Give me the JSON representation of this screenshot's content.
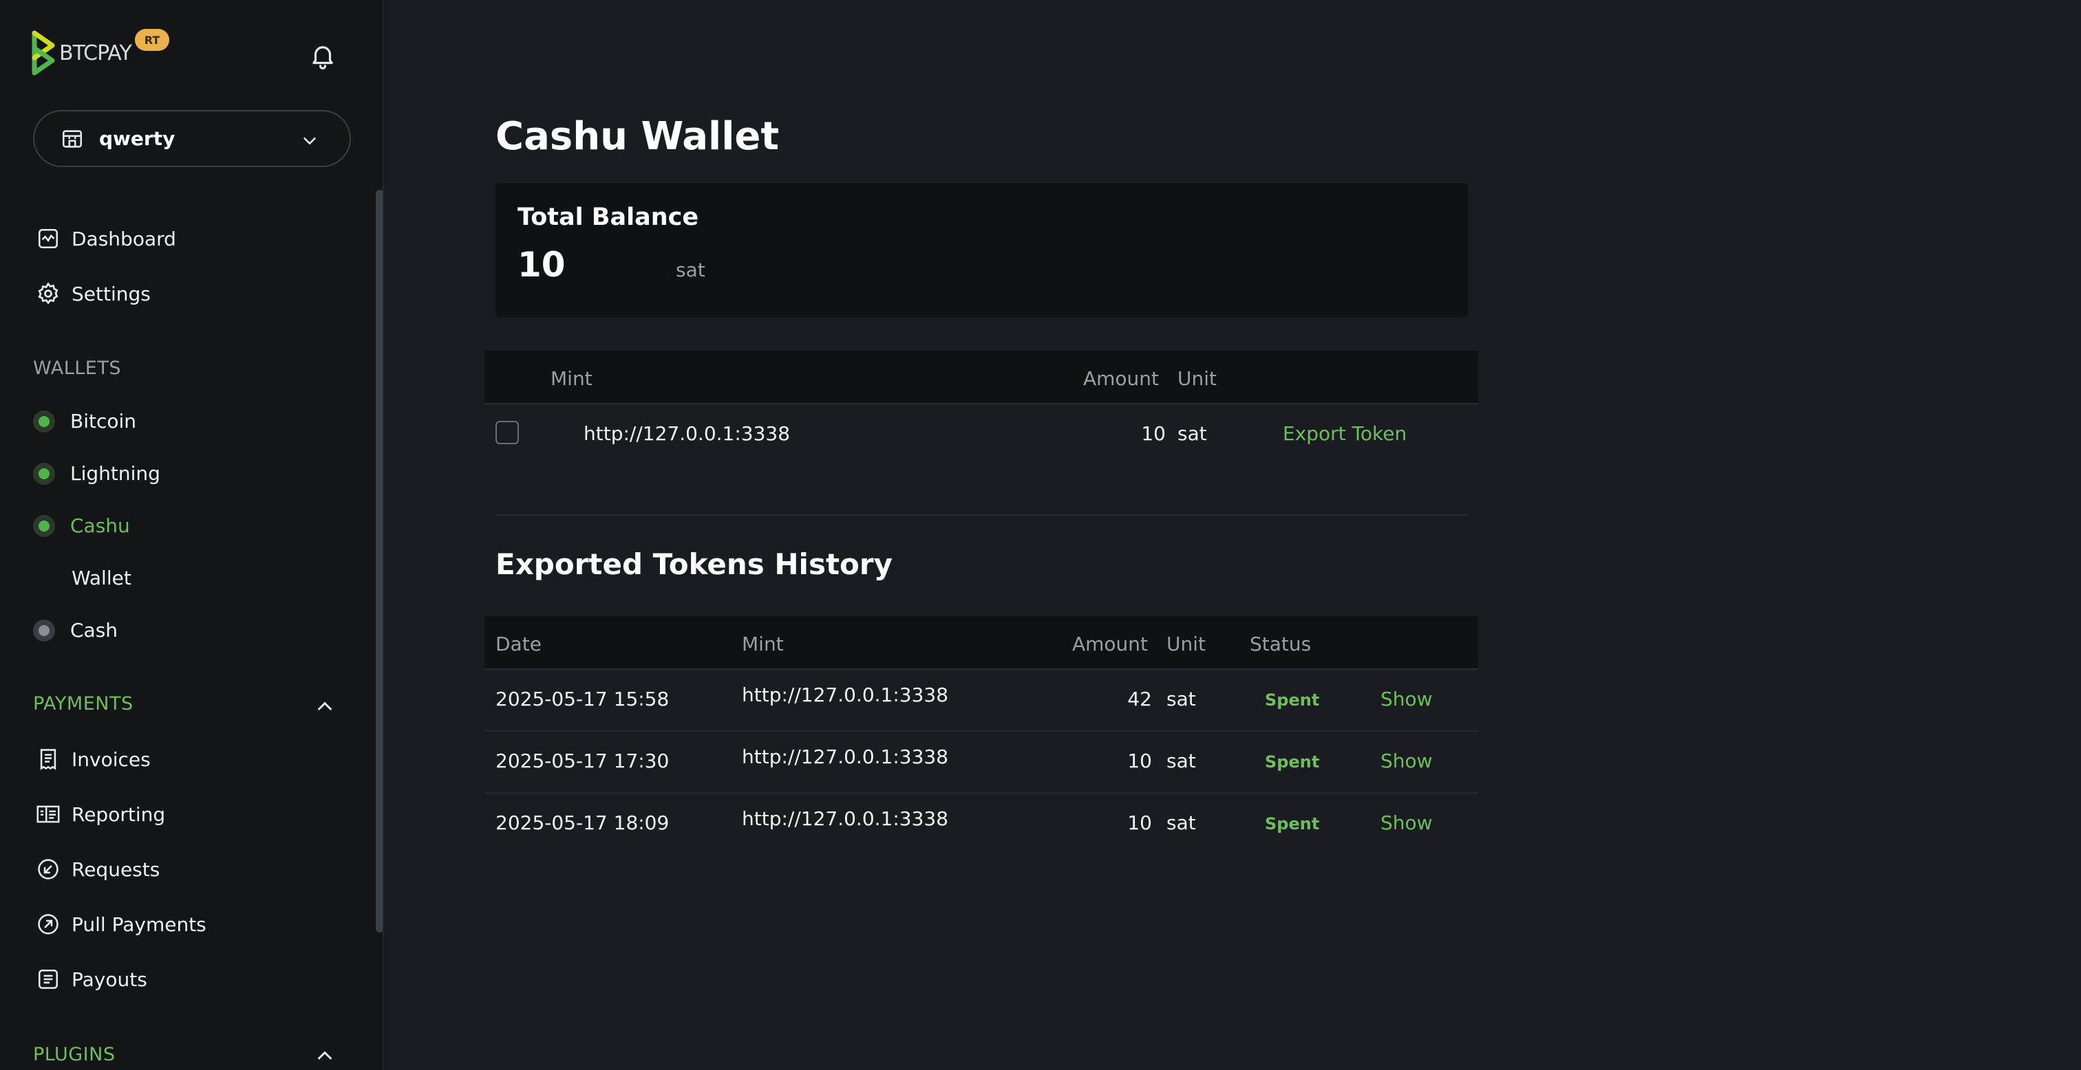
{
  "app": {
    "logo_text": "BTCPAY",
    "badge": "RT",
    "colors": {
      "accent": "#6dbf5a",
      "badge": "#e9b24f",
      "bg": "#1a1c21",
      "sidebar": "#131517"
    }
  },
  "sidebar": {
    "store": {
      "name": "qwerty",
      "icon": "store-icon"
    },
    "top_items": [
      {
        "label": "Dashboard",
        "icon": "dashboard-icon"
      },
      {
        "label": "Settings",
        "icon": "gear-icon"
      }
    ],
    "wallets": {
      "heading": "WALLETS",
      "items": [
        {
          "label": "Bitcoin",
          "status": "active"
        },
        {
          "label": "Lightning",
          "status": "active"
        },
        {
          "label": "Cashu",
          "status": "active",
          "selected": true
        },
        {
          "label": "Wallet",
          "sub": true
        },
        {
          "label": "Cash",
          "status": "inactive"
        }
      ]
    },
    "payments": {
      "heading": "PAYMENTS",
      "items": [
        {
          "label": "Invoices",
          "icon": "invoice-icon"
        },
        {
          "label": "Reporting",
          "icon": "reporting-icon"
        },
        {
          "label": "Requests",
          "icon": "request-icon"
        },
        {
          "label": "Pull Payments",
          "icon": "pull-payment-icon"
        },
        {
          "label": "Payouts",
          "icon": "payout-icon"
        }
      ]
    },
    "plugins": {
      "heading": "PLUGINS"
    }
  },
  "main": {
    "title": "Cashu Wallet",
    "balance": {
      "label": "Total Balance",
      "value": "10",
      "unit": "sat"
    },
    "mint_table": {
      "headers": {
        "mint": "Mint",
        "amount": "Amount",
        "unit": "Unit"
      },
      "rows": [
        {
          "mint": "http://127.0.0.1:3338",
          "amount": "10",
          "unit": "sat",
          "action": "Export Token"
        }
      ]
    },
    "history": {
      "title": "Exported Tokens History",
      "headers": {
        "date": "Date",
        "mint": "Mint",
        "amount": "Amount",
        "unit": "Unit",
        "status": "Status"
      },
      "rows": [
        {
          "date": "2025-05-17 15:58",
          "mint": "http://127.0.0.1:3338",
          "amount": "42",
          "unit": "sat",
          "status": "Spent",
          "action": "Show"
        },
        {
          "date": "2025-05-17 17:30",
          "mint": "http://127.0.0.1:3338",
          "amount": "10",
          "unit": "sat",
          "status": "Spent",
          "action": "Show"
        },
        {
          "date": "2025-05-17 18:09",
          "mint": "http://127.0.0.1:3338",
          "amount": "10",
          "unit": "sat",
          "status": "Spent",
          "action": "Show"
        }
      ]
    }
  }
}
